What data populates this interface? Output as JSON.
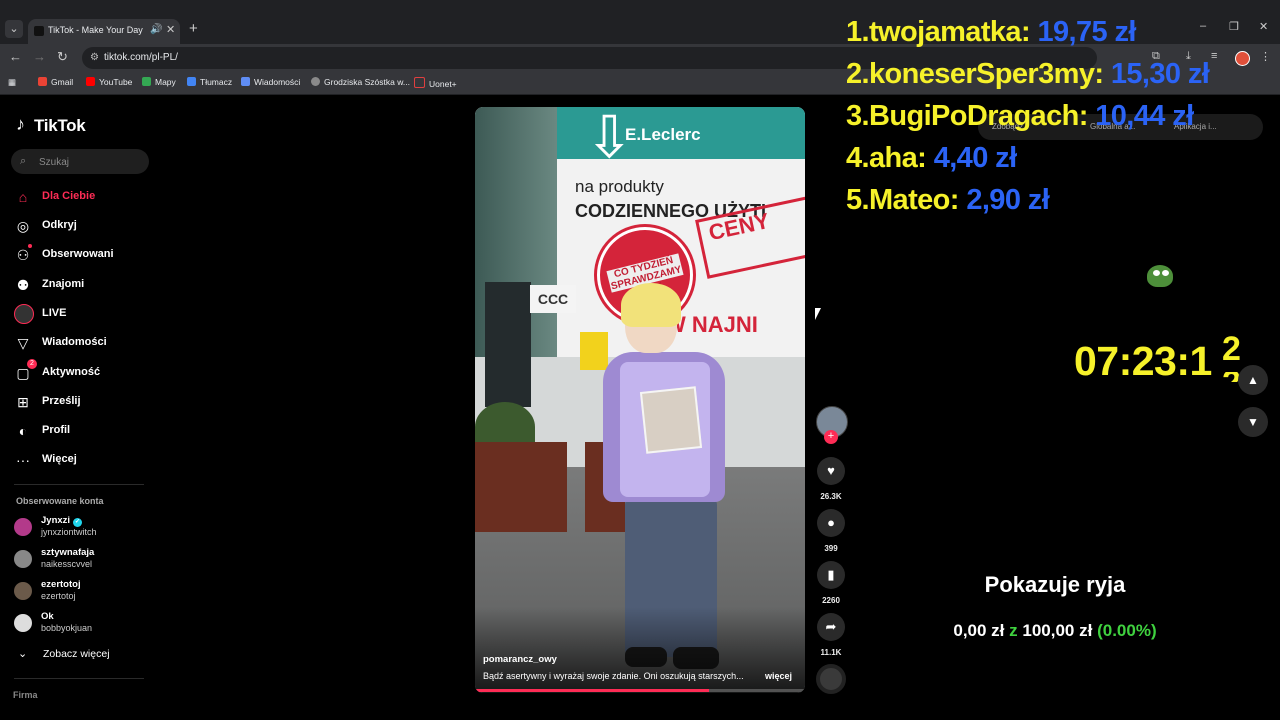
{
  "browser": {
    "tab_title": "TikTok - Make Your Day",
    "url": "tiktok.com/pl-PL/",
    "bookmarks": [
      "Gmail",
      "YouTube",
      "Mapy",
      "Tłumacz",
      "Wiadomości",
      "Grodziska Szóstka w...",
      "Uonet+"
    ]
  },
  "sidebar": {
    "logo": "TikTok",
    "search_placeholder": "Szukaj",
    "nav": [
      {
        "label": "Dla Ciebie",
        "icon": "home-icon"
      },
      {
        "label": "Odkryj",
        "icon": "compass-icon"
      },
      {
        "label": "Obserwowani",
        "icon": "following-icon"
      },
      {
        "label": "Znajomi",
        "icon": "friends-icon"
      },
      {
        "label": "LIVE",
        "icon": "live-icon"
      },
      {
        "label": "Wiadomości",
        "icon": "messages-icon"
      },
      {
        "label": "Aktywność",
        "icon": "activity-icon",
        "badge": "2"
      },
      {
        "label": "Prześlij",
        "icon": "upload-icon"
      },
      {
        "label": "Profil",
        "icon": "profile-icon"
      },
      {
        "label": "Więcej",
        "icon": "more-icon"
      }
    ],
    "followed_header": "Obserwowane konta",
    "followed": [
      {
        "name": "Jynxzi",
        "handle": "jynxziontwitch",
        "verified": true
      },
      {
        "name": "sztywnafaja",
        "handle": "naikesscvvel"
      },
      {
        "name": "ezertotoj",
        "handle": "ezertotoj"
      },
      {
        "name": "Ok",
        "handle": "bobbyokjuan"
      }
    ],
    "see_more": "Zobacz więcej",
    "footer": "Firma"
  },
  "video": {
    "author": "pomarancz_owy",
    "description": "Bądź asertywny i wyrażaj swoje zdanie. Oni oszukują starszych...",
    "more": "więcej",
    "scene_text": {
      "brand": "E.Leclerc",
      "line1": "na produkty",
      "line2": "CODZIENNEGO UŻYTI",
      "stamp": "CO TYDZIEŃ SPRAWDZAMY CENY",
      "ceny": "CENY",
      "najni": "W NAJNI",
      "ccc": "CCC"
    }
  },
  "actions": {
    "likes": "26.3K",
    "comments": "399",
    "saves": "2260",
    "shares": "11.1K"
  },
  "overlay": {
    "leaderboard": [
      {
        "rank": "1.",
        "name": "twojamatka",
        "amount": "19,75 zł"
      },
      {
        "rank": "2.",
        "name": "koneserSper3my",
        "amount": "15,30 zł"
      },
      {
        "rank": "3.",
        "name": "BugiPoDragach",
        "amount": "10,44 zł"
      },
      {
        "rank": "4.",
        "name": "aha",
        "amount": "4,40 zł"
      },
      {
        "rank": "5.",
        "name": "Mateo",
        "amount": "2,90 zł"
      }
    ],
    "timer": "07:23:1",
    "timer_sup": "2",
    "goal_title": "Pokazuje ryja",
    "goal_current": "0,00 zł",
    "goal_sep": "z",
    "goal_target": "100,00 zł",
    "goal_percent": "(0.00%)",
    "ghost_items": [
      "Zdobądź",
      "Globalna a...",
      "Aplikacja i..."
    ]
  },
  "colors": {
    "tiktok_red": "#fe2c55",
    "overlay_yellow": "#f6f12a",
    "overlay_blue": "#2b63f5",
    "overlay_green": "#3fd13f"
  }
}
